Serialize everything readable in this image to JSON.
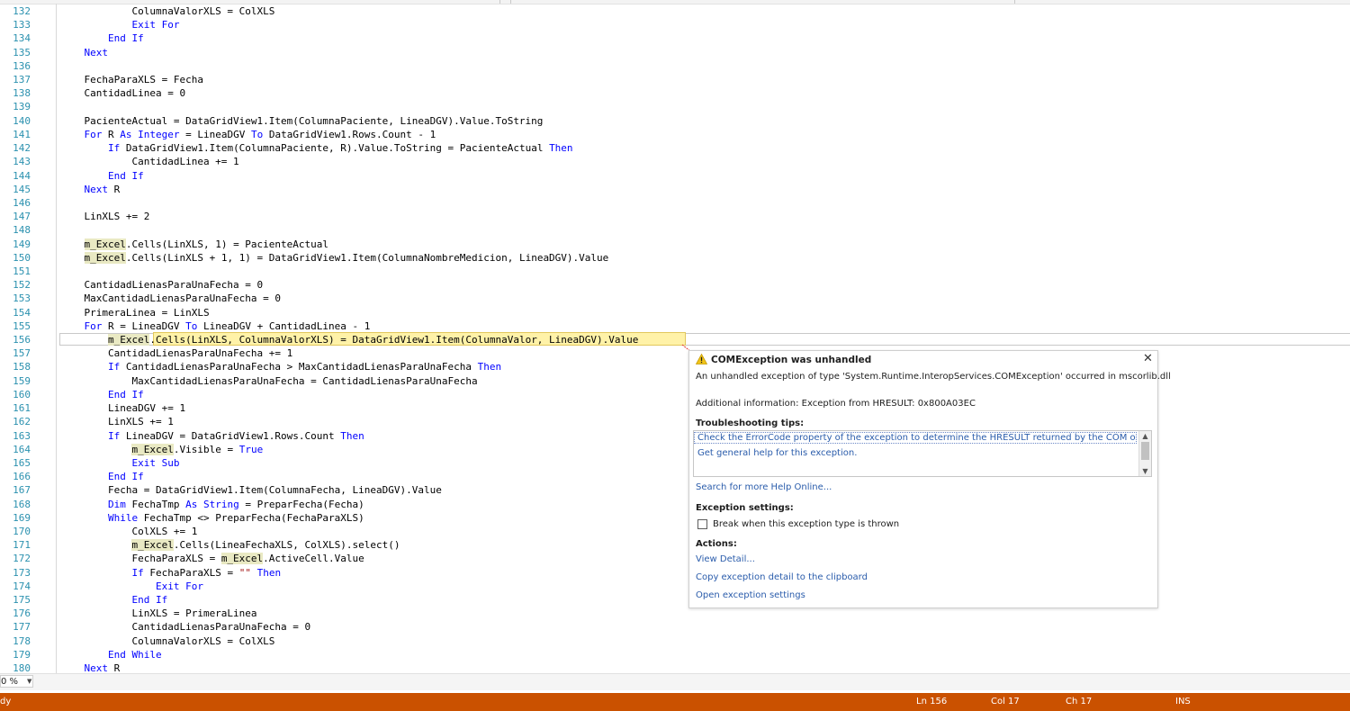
{
  "editor": {
    "lines": [
      {
        "n": "132",
        "html": "            ColumnaValorXLS = ColXLS"
      },
      {
        "n": "133",
        "html": "            <span class=\"kw\">Exit For</span>"
      },
      {
        "n": "134",
        "html": "        <span class=\"kw\">End If</span>"
      },
      {
        "n": "135",
        "html": "    <span class=\"kw\">Next</span>"
      },
      {
        "n": "136",
        "html": ""
      },
      {
        "n": "137",
        "html": "    FechaParaXLS = Fecha"
      },
      {
        "n": "138",
        "html": "    CantidadLinea = 0"
      },
      {
        "n": "139",
        "html": ""
      },
      {
        "n": "140",
        "html": "    PacienteActual = DataGridView1.Item(ColumnaPaciente, LineaDGV).Value.ToString"
      },
      {
        "n": "141",
        "html": "    <span class=\"kw\">For</span> R <span class=\"kw\">As Integer</span> = LineaDGV <span class=\"kw\">To</span> DataGridView1.Rows.Count - 1"
      },
      {
        "n": "142",
        "html": "        <span class=\"kw\">If</span> DataGridView1.Item(ColumnaPaciente, R).Value.ToString = PacienteActual <span class=\"kw\">Then</span>"
      },
      {
        "n": "143",
        "html": "            CantidadLinea += 1"
      },
      {
        "n": "144",
        "html": "        <span class=\"kw\">End If</span>"
      },
      {
        "n": "145",
        "html": "    <span class=\"kw\">Next</span> R"
      },
      {
        "n": "146",
        "html": ""
      },
      {
        "n": "147",
        "html": "    LinXLS += 2"
      },
      {
        "n": "148",
        "html": ""
      },
      {
        "n": "149",
        "html": "    <span class=\"hl\">m_Excel</span>.Cells(LinXLS, 1) = PacienteActual"
      },
      {
        "n": "150",
        "html": "    <span class=\"hl\">m_Excel</span>.Cells(LinXLS + 1, 1) = DataGridView1.Item(ColumnaNombreMedicion, LineaDGV).Value"
      },
      {
        "n": "151",
        "html": ""
      },
      {
        "n": "152",
        "html": "    CantidadLienasParaUnaFecha = 0"
      },
      {
        "n": "153",
        "html": "    MaxCantidadLienasParaUnaFecha = 0"
      },
      {
        "n": "154",
        "html": "    PrimeraLinea = LinXLS"
      },
      {
        "n": "155",
        "html": "    <span class=\"kw\">For</span> R = LineaDGV <span class=\"kw\">To</span> LineaDGV + CantidadLinea - 1"
      },
      {
        "n": "156",
        "html": "        <span class=\"hl\">m_Excel</span>.Cells(LinXLS, ColumnaValorXLS) = DataGridView1.Item(ColumnaValor, LineaDGV).Value"
      },
      {
        "n": "157",
        "html": "        CantidadLienasParaUnaFecha += 1"
      },
      {
        "n": "158",
        "html": "        <span class=\"kw\">If</span> CantidadLienasParaUnaFecha &gt; MaxCantidadLienasParaUnaFecha <span class=\"kw\">Then</span>"
      },
      {
        "n": "159",
        "html": "            MaxCantidadLienasParaUnaFecha = CantidadLienasParaUnaFecha"
      },
      {
        "n": "160",
        "html": "        <span class=\"kw\">End If</span>"
      },
      {
        "n": "161",
        "html": "        LineaDGV += 1"
      },
      {
        "n": "162",
        "html": "        LinXLS += 1"
      },
      {
        "n": "163",
        "html": "        <span class=\"kw\">If</span> LineaDGV = DataGridView1.Rows.Count <span class=\"kw\">Then</span>"
      },
      {
        "n": "164",
        "html": "            <span class=\"hl\">m_Excel</span>.Visible = <span class=\"kw\">True</span>"
      },
      {
        "n": "165",
        "html": "            <span class=\"kw\">Exit Sub</span>"
      },
      {
        "n": "166",
        "html": "        <span class=\"kw\">End If</span>"
      },
      {
        "n": "167",
        "html": "        Fecha = DataGridView1.Item(ColumnaFecha, LineaDGV).Value"
      },
      {
        "n": "168",
        "html": "        <span class=\"kw\">Dim</span> FechaTmp <span class=\"kw\">As String</span> = PreparFecha(Fecha)"
      },
      {
        "n": "169",
        "html": "        <span class=\"kw\">While</span> FechaTmp &lt;&gt; PreparFecha(FechaParaXLS)"
      },
      {
        "n": "170",
        "html": "            ColXLS += 1"
      },
      {
        "n": "171",
        "html": "            <span class=\"hl\">m_Excel</span>.Cells(LineaFechaXLS, ColXLS).select()"
      },
      {
        "n": "172",
        "html": "            FechaParaXLS = <span class=\"hl\">m_Excel</span>.ActiveCell.Value"
      },
      {
        "n": "173",
        "html": "            <span class=\"kw\">If</span> FechaParaXLS = <span class=\"str\">\"\"</span> <span class=\"kw\">Then</span>"
      },
      {
        "n": "174",
        "html": "                <span class=\"kw\">Exit For</span>"
      },
      {
        "n": "175",
        "html": "            <span class=\"kw\">End If</span>"
      },
      {
        "n": "176",
        "html": "            LinXLS = PrimeraLinea"
      },
      {
        "n": "177",
        "html": "            CantidadLienasParaUnaFecha = 0"
      },
      {
        "n": "178",
        "html": "            ColumnaValorXLS = ColXLS"
      },
      {
        "n": "179",
        "html": "        <span class=\"kw\">End While</span>"
      },
      {
        "n": "180",
        "html": "    <span class=\"kw\">Next</span> R"
      }
    ]
  },
  "exception": {
    "title": "COMException was unhandled",
    "message": "An unhandled exception of type 'System.Runtime.InteropServices.COMException' occurred in mscorlib.dll",
    "additional_info": "Additional information: Exception from HRESULT: 0x800A03EC",
    "tips_header": "Troubleshooting tips:",
    "tips": [
      "Check the ErrorCode property of the exception to determine the HRESULT returned by the COM object.",
      "Get general help for this exception."
    ],
    "search_link": "Search for more Help Online...",
    "settings_header": "Exception settings:",
    "break_checkbox_label": "Break when this exception type is thrown",
    "break_checked": false,
    "actions_header": "Actions:",
    "actions": [
      "View Detail...",
      "Copy exception detail to the clipboard",
      "Open exception settings"
    ]
  },
  "zoom": {
    "value": "0 %"
  },
  "status_bar": {
    "state": "dy",
    "line": "Ln 156",
    "col": "Col 17",
    "ch": "Ch 17",
    "mode": "INS"
  },
  "colors": {
    "status_bar": "#ca5100",
    "keyword": "#0000ff",
    "line_number": "#2b91af",
    "link": "#2a5cab"
  }
}
